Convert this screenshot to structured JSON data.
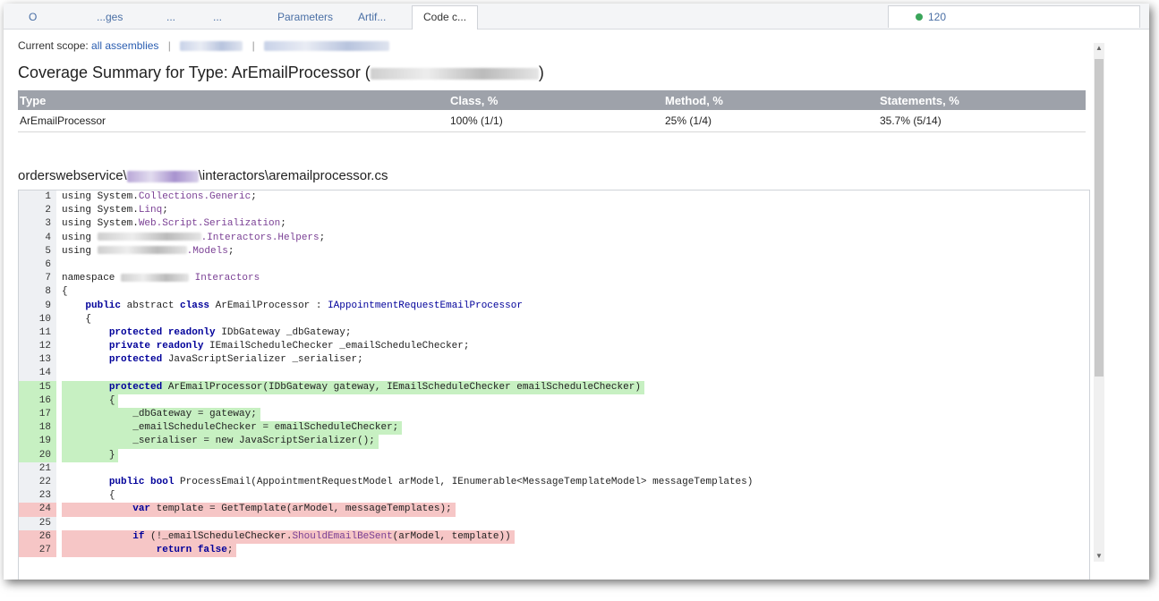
{
  "tabs": {
    "items": [
      "O",
      "...ges",
      "...",
      "...",
      "Parameters",
      "Artif...",
      "Code c..."
    ],
    "right_count": "120"
  },
  "scope": {
    "label": "Current scope:",
    "all_assemblies": "all assemblies"
  },
  "summary": {
    "title_prefix": "Coverage Summary for Type: ArEmailProcessor (",
    "title_suffix": ")",
    "headers": [
      "Type",
      "Class, %",
      "Method, %",
      "Statements, %"
    ],
    "row": [
      "ArEmailProcessor",
      "100% (1/1)",
      "25% (1/4)",
      "35.7% (5/14)"
    ]
  },
  "file": {
    "prefix": "orderswebservice\\",
    "suffix": "\\interactors\\aremailprocessor.cs"
  },
  "code": {
    "lines": [
      {
        "n": "1",
        "s": "none"
      },
      {
        "n": "2",
        "s": "none"
      },
      {
        "n": "3",
        "s": "none"
      },
      {
        "n": "4",
        "s": "none"
      },
      {
        "n": "5",
        "s": "none"
      },
      {
        "n": "6",
        "s": "none"
      },
      {
        "n": "7",
        "s": "none"
      },
      {
        "n": "8",
        "s": "none"
      },
      {
        "n": "9",
        "s": "none"
      },
      {
        "n": "10",
        "s": "none"
      },
      {
        "n": "11",
        "s": "none"
      },
      {
        "n": "12",
        "s": "none"
      },
      {
        "n": "13",
        "s": "none"
      },
      {
        "n": "14",
        "s": "none"
      },
      {
        "n": "15",
        "s": "covered"
      },
      {
        "n": "16",
        "s": "covered"
      },
      {
        "n": "17",
        "s": "covered"
      },
      {
        "n": "18",
        "s": "covered"
      },
      {
        "n": "19",
        "s": "covered"
      },
      {
        "n": "20",
        "s": "covered"
      },
      {
        "n": "21",
        "s": "none"
      },
      {
        "n": "22",
        "s": "none"
      },
      {
        "n": "23",
        "s": "none"
      },
      {
        "n": "24",
        "s": "uncovered"
      },
      {
        "n": "25",
        "s": "none"
      },
      {
        "n": "26",
        "s": "uncovered"
      },
      {
        "n": "27",
        "s": "uncovered"
      }
    ],
    "text": {
      "l1a": "using ",
      "l1b": "System.",
      "l1c": "Collections.Generic",
      ";": ";",
      "l2a": "using System.",
      "l2b": "Linq",
      "l3a": "using System.",
      "l3b": "Web.Script.Serialization",
      "l4a": "using ",
      "l4b": ".Interactors.Helpers",
      "l5a": "using ",
      "l5b": ".Models",
      "l7a": "namespace ",
      "l7b": "Interactors",
      "l8": "{",
      "l9a": "public",
      "l9b": " abstract ",
      "l9c": "class",
      "l9d": " ArEmailProcessor : ",
      "l9e": "IAppointmentRequestEmailProcessor",
      "l10": "{",
      "l11a": "protected readonly",
      "l11b": " IDbGateway _dbGateway;",
      "l12a": "private readonly",
      "l12b": " IEmailScheduleChecker _emailScheduleChecker;",
      "l13a": "protected",
      "l13b": " JavaScriptSerializer _serialiser;",
      "l15a": "protected",
      "l15b": " ArEmailProcessor(IDbGateway gateway, IEmailScheduleChecker emailScheduleChecker)",
      "l16": "{",
      "l17": "_dbGateway = gateway;",
      "l18": "_emailScheduleChecker = emailScheduleChecker;",
      "l19a": "_serialiser = ",
      "l19b": "new",
      "l19c": " JavaScriptSerializer();",
      "l20": "}",
      "l22a": "public bool",
      "l22b": " ProcessEmail(AppointmentRequestModel arModel, IEnumerable<MessageTemplateModel> messageTemplates)",
      "l23": "{",
      "l24a": "var",
      "l24b": " template = GetTemplate(arModel, messageTemplates);",
      "l26a": "if",
      "l26b": " (!_emailScheduleChecker.",
      "l26c": "ShouldEmailBeSent",
      "l26d": "(arModel, template))",
      "l27a": "return false",
      ";27": ";"
    }
  }
}
